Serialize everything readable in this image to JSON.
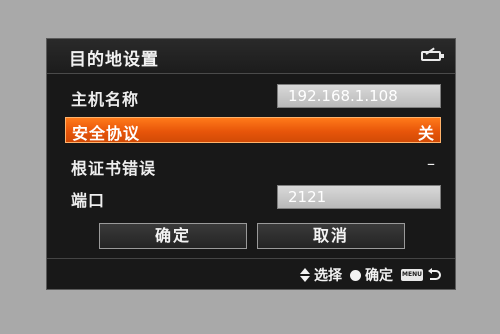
{
  "title": "目的地设置",
  "rows": [
    {
      "label": "主机名称",
      "value": "192.168.1.108"
    },
    {
      "label": "安全协议",
      "value": "关"
    },
    {
      "label": "根证书错误",
      "value": "–"
    },
    {
      "label": "端口",
      "value": "2121"
    }
  ],
  "buttons": {
    "ok": "确定",
    "cancel": "取消"
  },
  "footer": {
    "select_label": "选择",
    "confirm_label": "确定",
    "menu_icon_text": "MENU"
  },
  "colors": {
    "highlight": "#e8560a",
    "background": "#181818"
  },
  "icons": [
    "battery-icon",
    "updown-arrows-icon",
    "set-button-icon",
    "menu-button-icon",
    "return-arrow-icon"
  ]
}
